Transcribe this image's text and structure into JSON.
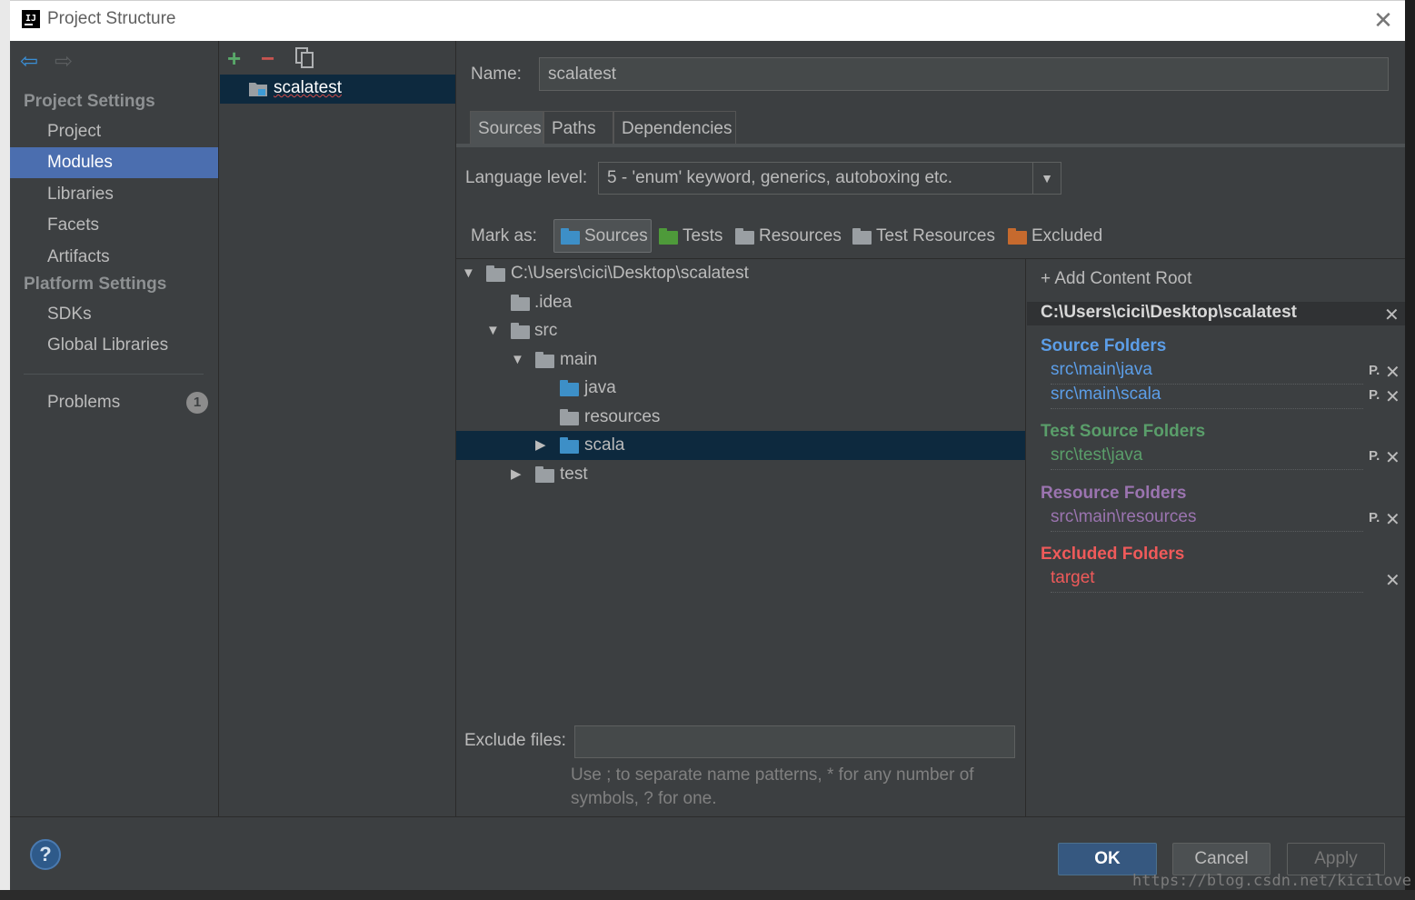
{
  "window": {
    "title": "Project Structure",
    "logo": "IJ"
  },
  "sidebar": {
    "project_settings_title": "Project Settings",
    "project_items": [
      "Project",
      "Modules",
      "Libraries",
      "Facets",
      "Artifacts"
    ],
    "platform_settings_title": "Platform Settings",
    "platform_items": [
      "SDKs",
      "Global Libraries"
    ],
    "problems_label": "Problems",
    "problems_count": "1",
    "selected": "Modules"
  },
  "modules": {
    "items": [
      "scalatest"
    ]
  },
  "main": {
    "name_label": "Name:",
    "name_value": "scalatest",
    "tabs": [
      "Sources",
      "Paths",
      "Dependencies"
    ],
    "active_tab": "Sources",
    "language_label": "Language level:",
    "language_value": "5 - 'enum' keyword, generics, autoboxing etc.",
    "mark_as_label": "Mark as:",
    "mark_as": [
      "Sources",
      "Tests",
      "Resources",
      "Test Resources",
      "Excluded"
    ],
    "tree": [
      "C:\\Users\\cici\\Desktop\\scalatest",
      ".idea",
      "src",
      "main",
      "java",
      "resources",
      "scala",
      "test"
    ],
    "exclude_label": "Exclude files:",
    "exclude_hint": "Use ; to separate name patterns, * for any number of symbols, ? for one."
  },
  "content_root": {
    "add_label": "Add Content Root",
    "path": "C:\\Users\\cici\\Desktop\\scalatest",
    "source_title": "Source Folders",
    "source_folders": [
      "src\\main\\java",
      "src\\main\\scala"
    ],
    "test_title": "Test Source Folders",
    "test_folders": [
      "src\\test\\java"
    ],
    "resource_title": "Resource Folders",
    "resource_folders": [
      "src\\main\\resources"
    ],
    "excluded_title": "Excluded Folders",
    "excluded_folders": [
      "target"
    ],
    "props_glyph": "P."
  },
  "footer": {
    "help": "?",
    "ok": "OK",
    "cancel": "Cancel",
    "apply": "Apply",
    "watermark": "https://blog.csdn.net/kicilove"
  },
  "colors": {
    "source": "#5c9ee8",
    "test": "#5a9e6a",
    "resource": "#9b74b0",
    "excluded": "#ef5a5a",
    "folder_gray": "#9a9fa3",
    "folder_blue": "#3d8fc7",
    "folder_green": "#4e9a3a",
    "folder_orange": "#c66a2e",
    "selection": "#0d293e",
    "accent": "#4b6eaf"
  }
}
